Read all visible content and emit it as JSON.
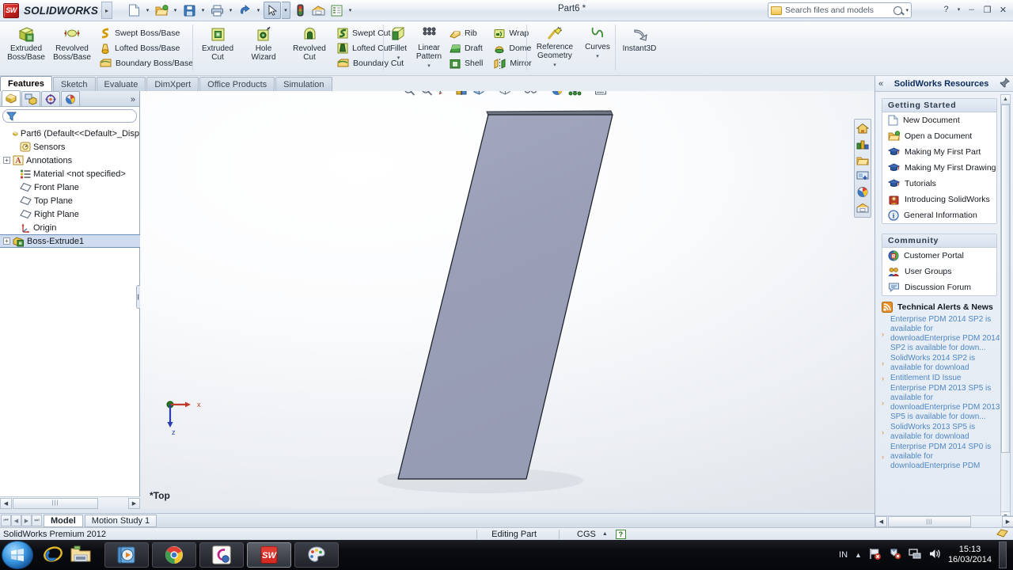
{
  "titlebar": {
    "brand": "SOLIDWORKS",
    "brand_mark": "SW",
    "doc_title": "Part6 *",
    "quick_access": [
      {
        "name": "new-document",
        "icon": "new-doc-icon",
        "caret": true
      },
      {
        "name": "open-document",
        "icon": "open-folder-icon",
        "caret": true
      },
      {
        "name": "save",
        "icon": "save-disk-icon",
        "caret": true
      },
      {
        "name": "print",
        "icon": "printer-icon",
        "caret": true
      },
      {
        "name": "undo",
        "icon": "undo-arrow-icon",
        "caret": true
      },
      {
        "name": "select",
        "icon": "cursor-arrow-icon",
        "caret": true,
        "selected": true
      },
      {
        "name": "rebuild",
        "icon": "traffic-light-icon",
        "caret": false
      },
      {
        "name": "options",
        "icon": "gear-options-icon",
        "caret": false
      },
      {
        "name": "customize",
        "icon": "list-options-icon",
        "caret": true
      }
    ],
    "search": {
      "placeholder": "Search files and models"
    },
    "window_controls": [
      "help",
      "help-caret",
      "minimize",
      "restore",
      "close"
    ]
  },
  "ribbon": {
    "groups": [
      {
        "name": "boss-base",
        "big": [
          {
            "label_line1": "Extruded",
            "label_line2": "Boss/Base",
            "icon": "extruded-boss-icon"
          },
          {
            "label_line1": "Revolved",
            "label_line2": "Boss/Base",
            "icon": "revolved-boss-icon"
          }
        ],
        "small": [
          {
            "label": "Swept Boss/Base",
            "icon": "swept-boss-icon"
          },
          {
            "label": "Lofted Boss/Base",
            "icon": "lofted-boss-icon"
          },
          {
            "label": "Boundary Boss/Base",
            "icon": "boundary-boss-icon"
          }
        ]
      },
      {
        "name": "cut",
        "big": [
          {
            "label_line1": "Extruded",
            "label_line2": "Cut",
            "icon": "extruded-cut-icon"
          },
          {
            "label_line1": "Hole",
            "label_line2": "Wizard",
            "icon": "hole-wizard-icon"
          },
          {
            "label_line1": "Revolved",
            "label_line2": "Cut",
            "icon": "revolved-cut-icon"
          }
        ],
        "small": [
          {
            "label": "Swept Cut",
            "icon": "swept-cut-icon"
          },
          {
            "label": "Lofted Cut",
            "icon": "lofted-cut-icon"
          },
          {
            "label": "Boundary Cut",
            "icon": "boundary-cut-icon"
          }
        ]
      },
      {
        "name": "features",
        "big": [
          {
            "label_line1": "Fillet",
            "label_line2": "",
            "icon": "fillet-icon",
            "caret": true
          },
          {
            "label_line1": "Linear",
            "label_line2": "Pattern",
            "icon": "linear-pattern-icon",
            "caret": true
          }
        ],
        "small_a": [
          {
            "label": "Rib",
            "icon": "rib-icon"
          },
          {
            "label": "Draft",
            "icon": "draft-icon"
          },
          {
            "label": "Shell",
            "icon": "shell-icon"
          }
        ],
        "small_b": [
          {
            "label": "Wrap",
            "icon": "wrap-icon"
          },
          {
            "label": "Dome",
            "icon": "dome-icon"
          },
          {
            "label": "Mirror",
            "icon": "mirror-icon"
          }
        ]
      },
      {
        "name": "reference",
        "big": [
          {
            "label_line1": "Reference",
            "label_line2": "Geometry",
            "icon": "reference-geometry-icon",
            "caret": true
          },
          {
            "label_line1": "Curves",
            "label_line2": "",
            "icon": "curves-icon",
            "caret": true
          }
        ]
      },
      {
        "name": "instant3d",
        "big": [
          {
            "label_line1": "Instant3D",
            "label_line2": "",
            "icon": "instant3d-icon"
          }
        ]
      }
    ],
    "tabs": [
      {
        "label": "Features",
        "active": true
      },
      {
        "label": "Sketch",
        "active": false
      },
      {
        "label": "Evaluate",
        "active": false
      },
      {
        "label": "DimXpert",
        "active": false
      },
      {
        "label": "Office Products",
        "active": false
      },
      {
        "label": "Simulation",
        "active": false
      }
    ]
  },
  "feature_manager": {
    "tabs": [
      {
        "name": "feature-tree-tab",
        "icon": "feature-tree-icon",
        "active": true
      },
      {
        "name": "property-manager-tab",
        "icon": "property-manager-icon",
        "active": false
      },
      {
        "name": "configuration-manager-tab",
        "icon": "configuration-icon",
        "active": false
      },
      {
        "name": "display-manager-tab",
        "icon": "display-manager-icon",
        "active": false
      }
    ],
    "more_label": "»",
    "filter": {
      "icon": "filter-funnel-icon",
      "value": ""
    },
    "tree": [
      {
        "label": "Part6  (Default<<Default>_Disp",
        "icon": "part-icon",
        "indent": 0,
        "expander": "none",
        "selected": false
      },
      {
        "label": "Sensors",
        "icon": "sensors-icon",
        "indent": 1,
        "expander": "none",
        "selected": false
      },
      {
        "label": "Annotations",
        "icon": "annotations-icon",
        "indent": 1,
        "expander": "plus",
        "selected": false
      },
      {
        "label": "Material <not specified>",
        "icon": "material-icon",
        "indent": 1,
        "expander": "none",
        "selected": false
      },
      {
        "label": "Front Plane",
        "icon": "plane-icon",
        "indent": 1,
        "expander": "none",
        "selected": false
      },
      {
        "label": "Top Plane",
        "icon": "plane-icon",
        "indent": 1,
        "expander": "none",
        "selected": false
      },
      {
        "label": "Right Plane",
        "icon": "plane-icon",
        "indent": 1,
        "expander": "none",
        "selected": false
      },
      {
        "label": "Origin",
        "icon": "origin-icon",
        "indent": 1,
        "expander": "none",
        "selected": false
      },
      {
        "label": "Boss-Extrude1",
        "icon": "boss-extrude-icon",
        "indent": 1,
        "expander": "plus",
        "selected": true
      }
    ]
  },
  "viewport": {
    "toolbar": [
      {
        "name": "zoom-to-fit",
        "icon": "zoom-fit-icon",
        "caret": false
      },
      {
        "name": "zoom-to-area",
        "icon": "zoom-area-icon",
        "caret": false
      },
      {
        "name": "previous-view",
        "icon": "previous-view-icon",
        "caret": false
      },
      {
        "name": "section-view",
        "icon": "section-view-icon",
        "caret": false
      },
      {
        "name": "view-orientation",
        "icon": "view-orientation-icon",
        "caret": true
      },
      {
        "name": "display-style",
        "icon": "display-style-icon",
        "caret": true
      },
      {
        "name": "hide-show-items",
        "icon": "glasses-icon",
        "caret": true
      },
      {
        "name": "apply-scene",
        "icon": "apply-scene-icon",
        "caret": false
      },
      {
        "name": "view-settings",
        "icon": "view-settings-icon",
        "caret": true
      },
      {
        "name": "rotate-view",
        "icon": "rotate-view-icon",
        "caret": true
      }
    ],
    "window_controls": [
      "restore-down-left",
      "restore-down-right",
      "minimize",
      "restore",
      "close"
    ],
    "side_buttons": [
      {
        "name": "home-button",
        "icon": "home-icon"
      },
      {
        "name": "3dcontentcentral-button",
        "icon": "content-central-icon"
      },
      {
        "name": "design-library-button",
        "icon": "design-library-folder-icon"
      },
      {
        "name": "file-explorer-button",
        "icon": "file-explorer-icon"
      },
      {
        "name": "appearances-button",
        "icon": "appearances-sphere-icon"
      },
      {
        "name": "custom-properties-button",
        "icon": "custom-properties-icon"
      }
    ],
    "orientation_label": "*Top",
    "triad": {
      "x_label": "x",
      "z_label": "z"
    },
    "model": {
      "name": "extruded-parallelogram-part",
      "face_color": "#9ba0b8",
      "edge_color": "#20242e",
      "top_edge_color": "#4a4f5e"
    }
  },
  "task_pane": {
    "collapse_label": "«",
    "title": "SolidWorks Resources",
    "pin_icon": "pushpin-icon",
    "sections": [
      {
        "title": "Getting Started",
        "items": [
          {
            "label": "New Document",
            "icon": "new-doc-icon"
          },
          {
            "label": "Open a Document",
            "icon": "open-folder-icon"
          },
          {
            "label": "Making My First Part",
            "icon": "graduation-cap-icon"
          },
          {
            "label": "Making My First Drawing",
            "icon": "graduation-cap-icon"
          },
          {
            "label": "Tutorials",
            "icon": "graduation-cap-icon"
          },
          {
            "label": "Introducing SolidWorks",
            "icon": "introducing-icon"
          },
          {
            "label": "General Information",
            "icon": "info-circle-icon"
          }
        ]
      },
      {
        "title": "Community",
        "items": [
          {
            "label": "Customer Portal",
            "icon": "customer-portal-icon"
          },
          {
            "label": "User Groups",
            "icon": "user-groups-icon"
          },
          {
            "label": "Discussion Forum",
            "icon": "discussion-forum-icon"
          }
        ]
      }
    ],
    "rss": {
      "title": "Technical Alerts & News",
      "icon": "rss-icon",
      "items": [
        "Enterprise PDM 2014 SP2 is available for downloadEnterprise PDM 2014 SP2 is available for down...",
        "SolidWorks 2014 SP2 is available for download",
        "Entitlement ID Issue",
        "Enterprise PDM 2013 SP5 is available for downloadEnterprise PDM 2013 SP5 is available for down...",
        "SolidWorks 2013 SP5 is available for download",
        "Enterprise PDM 2014 SP0 is available for downloadEnterprise PDM"
      ]
    }
  },
  "bottom_tabs": {
    "nav": [
      "first",
      "previous",
      "next",
      "last"
    ],
    "tabs": [
      {
        "label": "Model",
        "active": true
      },
      {
        "label": "Motion Study 1",
        "active": false
      }
    ]
  },
  "statusbar": {
    "left": "SolidWorks Premium 2012",
    "editing": "Editing Part",
    "units": "CGS",
    "units_caret": "▲",
    "help_badge": "?",
    "right_icon": "sw-badge-icon"
  },
  "taskbar": {
    "start_icon": "windows-start-icon",
    "quick_launch": [
      {
        "name": "internet-explorer-icon"
      },
      {
        "name": "windows-explorer-icon"
      }
    ],
    "items": [
      {
        "name": "media-player-task",
        "icon": "media-player-icon",
        "active": false
      },
      {
        "name": "chrome-task",
        "icon": "chrome-icon",
        "active": false
      },
      {
        "name": "corel-task",
        "icon": "corel-icon",
        "active": false
      },
      {
        "name": "solidworks-task",
        "icon": "solidworks-cube-icon",
        "active": true
      },
      {
        "name": "paint-task",
        "icon": "paint-palette-icon",
        "active": false
      }
    ],
    "tray": {
      "language": "IN",
      "overflow_icon": "show-hidden-icons-icon",
      "icons": [
        "flag-alert-icon",
        "security-alert-icon",
        "network-icon",
        "volume-icon"
      ],
      "time": "15:13",
      "date": "16/03/2014"
    }
  }
}
